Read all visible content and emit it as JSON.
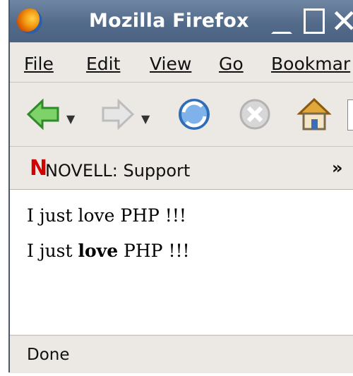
{
  "window": {
    "title": "Mozilla Firefox"
  },
  "menu": [
    "File",
    "Edit",
    "View",
    "Go",
    "Bookmar"
  ],
  "navbar": {
    "back_icon": "back-arrow-icon",
    "forward_icon": "forward-arrow-icon",
    "reload_icon": "reload-icon",
    "stop_icon": "stop-icon",
    "home_icon": "home-icon"
  },
  "bookmarks": {
    "item": "NOVELL: Support",
    "more": "»"
  },
  "content": {
    "line1": "I just love PHP !!!",
    "line2_prefix": "I just ",
    "line2_bold": "love",
    "line2_suffix": " PHP !!!"
  },
  "status": {
    "text": "Done"
  }
}
